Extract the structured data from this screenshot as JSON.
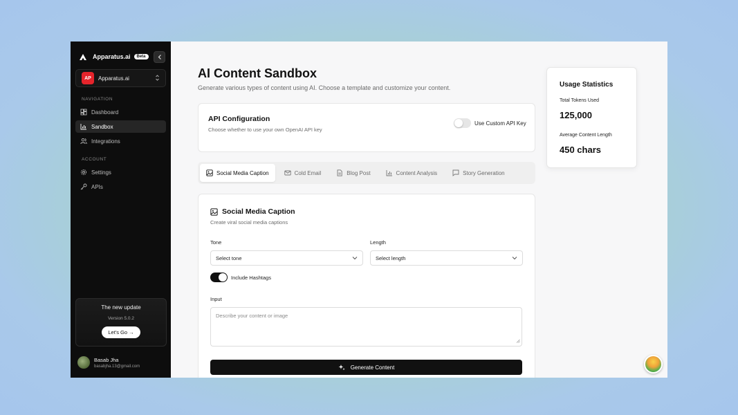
{
  "app": {
    "brand": "Apparatus.ai",
    "beta_badge": "Beta",
    "org": {
      "initials": "AP",
      "name": "Apparatus.ai"
    }
  },
  "sidebar": {
    "nav_section": "NAVIGATION",
    "nav_items": [
      {
        "label": "Dashboard",
        "icon": "dashboard-icon"
      },
      {
        "label": "Sandbox",
        "icon": "bar-chart-icon",
        "active": true
      },
      {
        "label": "Integrations",
        "icon": "users-icon"
      }
    ],
    "account_section": "ACCOUNT",
    "account_items": [
      {
        "label": "Settings",
        "icon": "gear-icon"
      },
      {
        "label": "APIs",
        "icon": "key-icon"
      }
    ],
    "update_card": {
      "title": "The new update",
      "version": "Version 5.0.2",
      "button": "Let's Go →"
    },
    "user": {
      "name": "Basab Jha",
      "email": "basabjha.13@gmail.com"
    }
  },
  "main": {
    "title": "AI Content Sandbox",
    "subtitle": "Generate various types of content using AI. Choose a template and customize your content.",
    "api_config": {
      "title": "API Configuration",
      "description": "Choose whether to use your own OpenAI API key",
      "toggle_label": "Use Custom API Key",
      "toggle_on": false
    },
    "tabs": [
      {
        "label": "Social Media Caption",
        "icon": "image-icon",
        "active": true
      },
      {
        "label": "Cold Email",
        "icon": "mail-icon"
      },
      {
        "label": "Blog Post",
        "icon": "document-icon"
      },
      {
        "label": "Content Analysis",
        "icon": "bar-chart-icon"
      },
      {
        "label": "Story Generation",
        "icon": "chat-icon"
      }
    ],
    "form": {
      "title": "Social Media Caption",
      "subtitle": "Create viral social media captions",
      "tone_label": "Tone",
      "tone_placeholder": "Select tone",
      "length_label": "Length",
      "length_placeholder": "Select length",
      "hashtags_label": "Include Hashtags",
      "hashtags_on": true,
      "input_label": "Input",
      "input_placeholder": "Describe your content or image",
      "generate_button": "Generate Content"
    }
  },
  "stats": {
    "title": "Usage Statistics",
    "tokens_label": "Total Tokens Used",
    "tokens_value": "125,000",
    "length_label": "Average Content Length",
    "length_value": "450 chars"
  }
}
